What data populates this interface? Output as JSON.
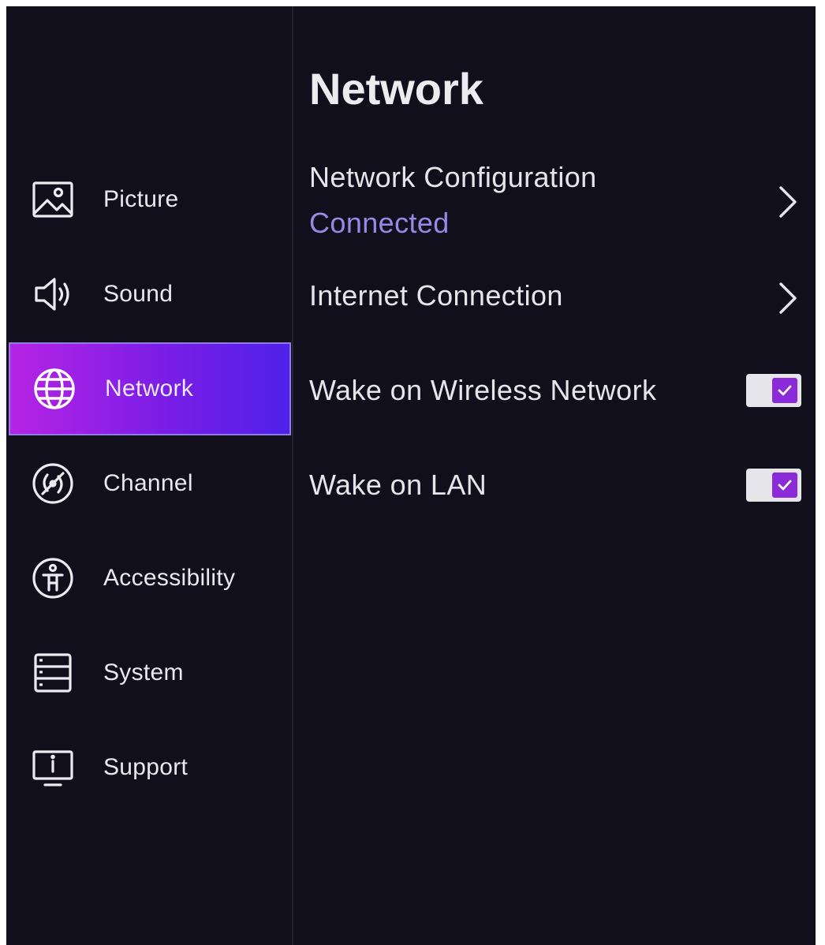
{
  "colors": {
    "background": "#110f1b",
    "accent_gradient_start": "#b624e4",
    "accent_gradient_end": "#4f21e8",
    "status_connected": "#9a88e6",
    "toggle_checked": "#8a2ad8"
  },
  "sidebar": {
    "items": [
      {
        "label": "Picture",
        "icon": "picture-icon",
        "active": false
      },
      {
        "label": "Sound",
        "icon": "speaker-icon",
        "active": false
      },
      {
        "label": "Network",
        "icon": "globe-icon",
        "active": true
      },
      {
        "label": "Channel",
        "icon": "channel-icon",
        "active": false
      },
      {
        "label": "Accessibility",
        "icon": "accessibility-icon",
        "active": false
      },
      {
        "label": "System",
        "icon": "system-icon",
        "active": false
      },
      {
        "label": "Support",
        "icon": "support-icon",
        "active": false
      }
    ]
  },
  "main": {
    "title": "Network",
    "rows": [
      {
        "label": "Network Configuration",
        "status": "Connected",
        "control": "chevron-right-icon"
      },
      {
        "label": "Internet Connection",
        "control": "chevron-right-icon"
      },
      {
        "label": "Wake on Wireless Network",
        "control": "checkbox",
        "checked": true
      },
      {
        "label": "Wake on LAN",
        "control": "checkbox",
        "checked": true
      }
    ]
  }
}
